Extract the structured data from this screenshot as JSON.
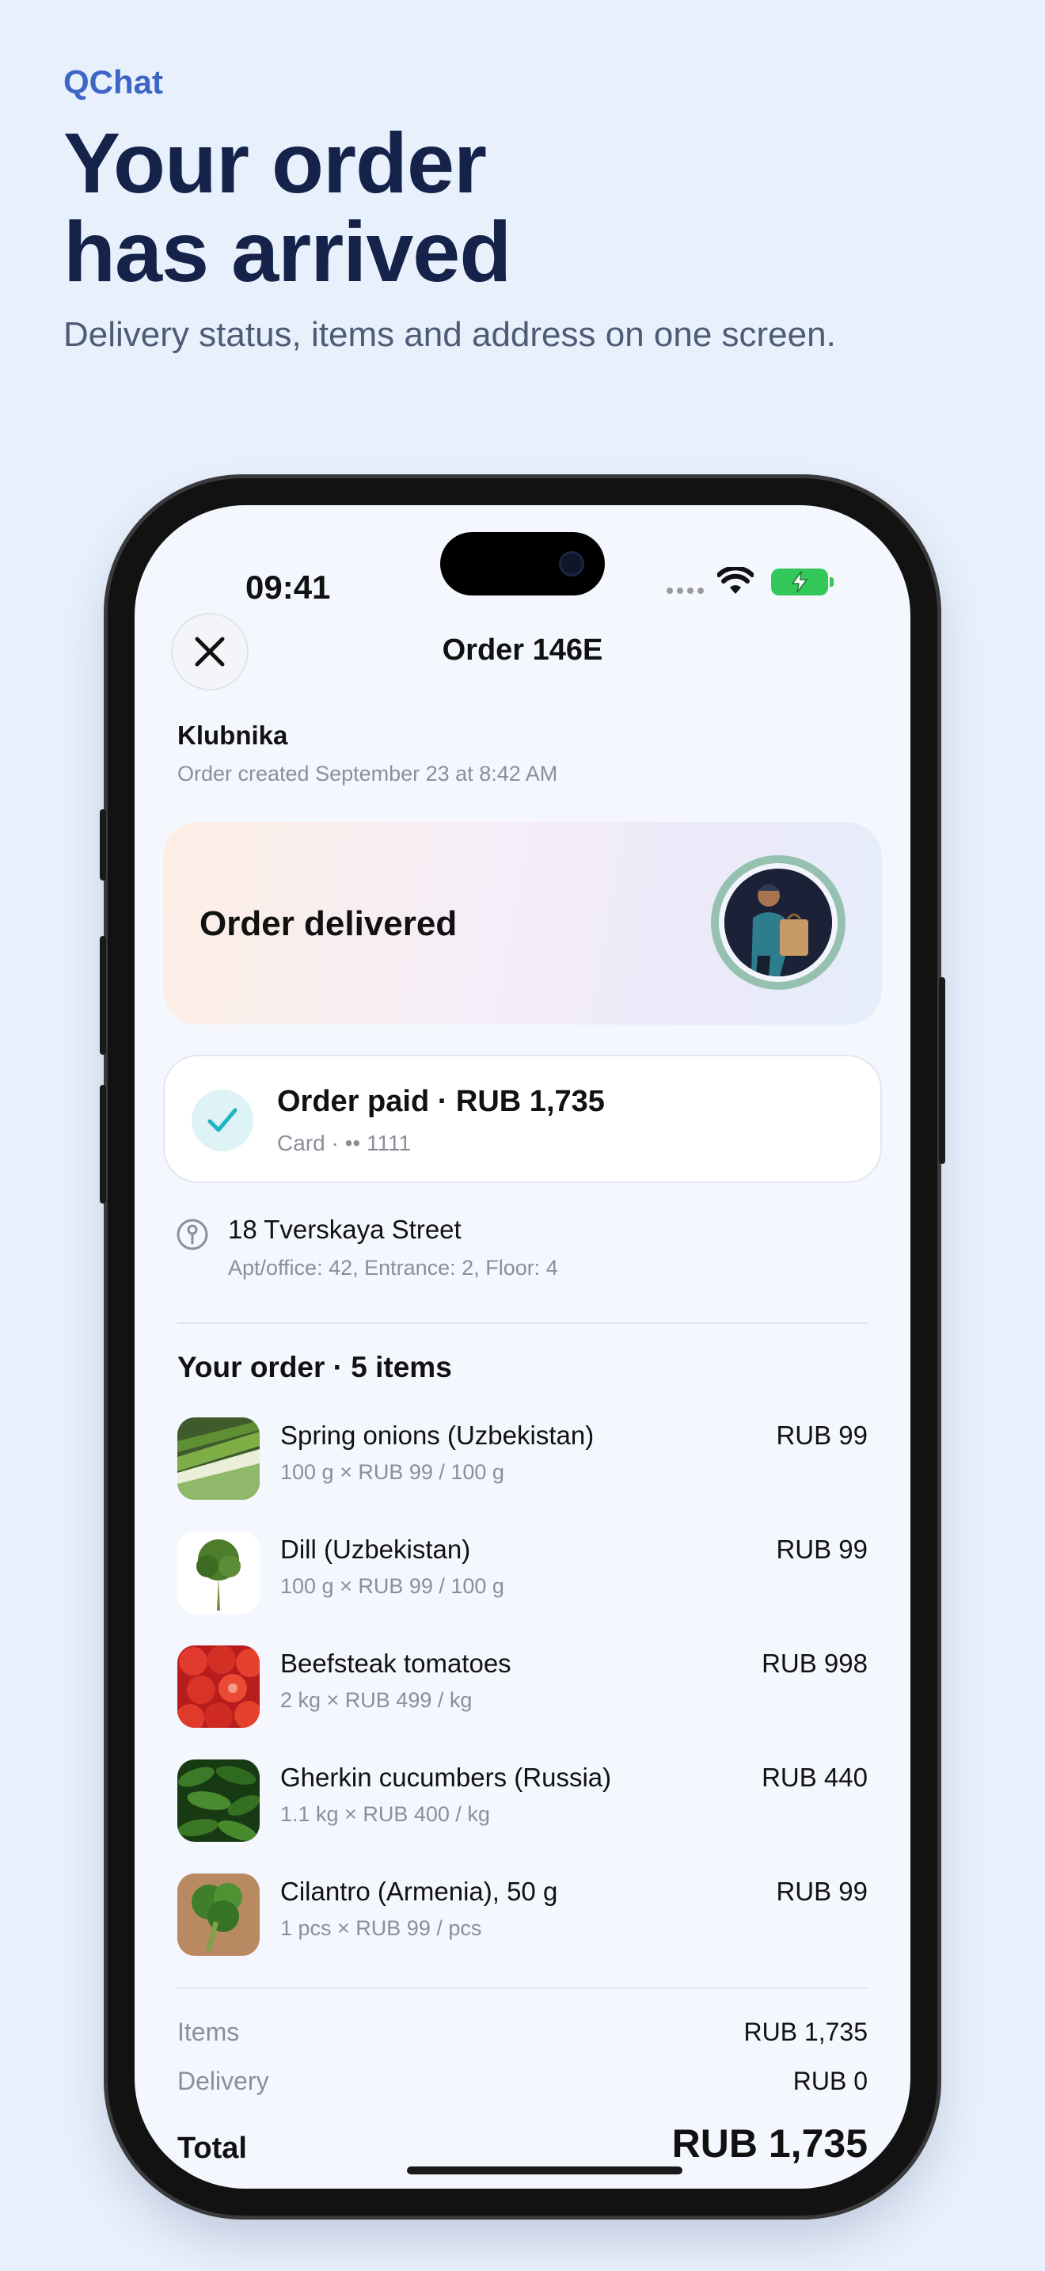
{
  "promo": {
    "brand": "QChat",
    "headline_line1": "Your order",
    "headline_line2": "has arrived",
    "subhead": "Delivery status, items and address on one screen."
  },
  "status_bar": {
    "time": "09:41"
  },
  "nav": {
    "title": "Order 146E",
    "close_icon": "close-icon"
  },
  "store": {
    "name": "Klubnika",
    "created": "Order created September 23 at 8:42 AM"
  },
  "status_card": {
    "label": "Order delivered"
  },
  "payment": {
    "title": "Order paid · RUB 1,735",
    "method": "Card · •• 1111"
  },
  "address": {
    "street": "18 Tverskaya Street",
    "details": "Apt/office: 42, Entrance: 2, Floor: 4"
  },
  "order": {
    "heading": "Your order · 5 items",
    "items": [
      {
        "name": "Spring onions (Uzbekistan)",
        "qty": "100 g × RUB 99 / 100 g",
        "price": "RUB 99"
      },
      {
        "name": "Dill (Uzbekistan)",
        "qty": "100 g × RUB 99 / 100 g",
        "price": "RUB 99"
      },
      {
        "name": "Beefsteak tomatoes",
        "qty": "2 kg × RUB 499 / kg",
        "price": "RUB 998"
      },
      {
        "name": "Gherkin cucumbers (Russia)",
        "qty": "1.1 kg × RUB 400 / kg",
        "price": "RUB 440"
      },
      {
        "name": "Cilantro (Armenia), 50 g",
        "qty": "1 pcs × RUB 99 / pcs",
        "price": "RUB 99"
      }
    ]
  },
  "summary": {
    "items_label": "Items",
    "items_value": "RUB 1,735",
    "delivery_label": "Delivery",
    "delivery_value": "RUB 0",
    "total_label": "Total",
    "total_value": "RUB 1,735"
  },
  "colors": {
    "brand": "#3d66c4",
    "headline": "#15234a",
    "background": "#e8f0fc",
    "battery": "#34c759",
    "check": "#1fb5c7"
  }
}
